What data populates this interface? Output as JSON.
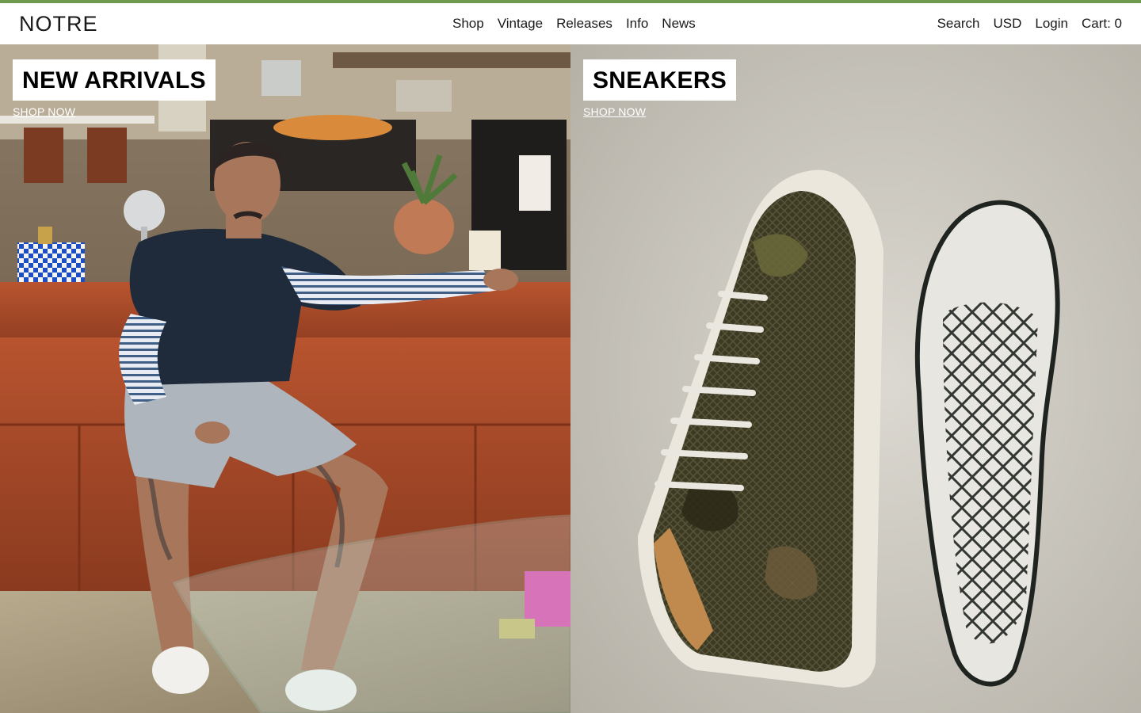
{
  "colors": {
    "accent_bar": "#6f9a4f"
  },
  "header": {
    "logo": "NOTRE",
    "nav_center": [
      {
        "label": "Shop"
      },
      {
        "label": "Vintage"
      },
      {
        "label": "Releases"
      },
      {
        "label": "Info"
      },
      {
        "label": "News"
      }
    ],
    "nav_right": {
      "search": "Search",
      "currency": "USD",
      "login": "Login",
      "cart": "Cart: 0"
    }
  },
  "panels": [
    {
      "title": "NEW ARRIVALS",
      "cta": "SHOP NOW",
      "image": "man-seated-on-leather-couch-photo"
    },
    {
      "title": "SNEAKERS",
      "cta": "SHOP NOW",
      "image": "camo-mesh-sneaker-and-sole-print-photo"
    }
  ]
}
